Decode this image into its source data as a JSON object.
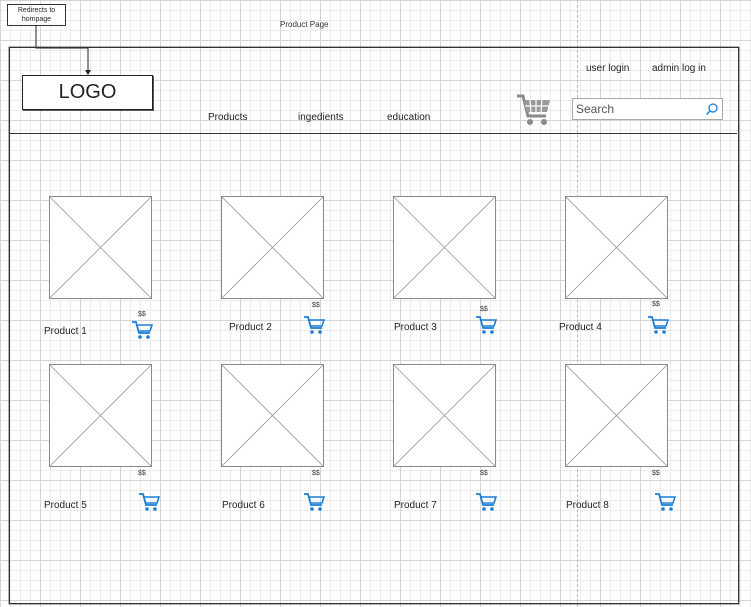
{
  "annotation": {
    "redirect_note": "Redirects to hompage"
  },
  "page_title": "Product Page",
  "header": {
    "logo": "LOGO",
    "nav": [
      "Products",
      "ingedients",
      "education"
    ],
    "user_login": "user login",
    "admin_login": "admin log in",
    "search_placeholder": "Search",
    "icons": {
      "cart": "shopping-cart-icon",
      "search": "search-icon"
    }
  },
  "products": [
    {
      "name": "Product 1",
      "price": "$$"
    },
    {
      "name": "Product 2",
      "price": "$$"
    },
    {
      "name": "Product 3",
      "price": "$$"
    },
    {
      "name": "Product 4",
      "price": "$$"
    },
    {
      "name": "Product 5",
      "price": "$$"
    },
    {
      "name": "Product 6",
      "price": "$$"
    },
    {
      "name": "Product 7",
      "price": "$$"
    },
    {
      "name": "Product 8",
      "price": "$$"
    }
  ],
  "colors": {
    "accent": "#1a7fd4",
    "cart_gray": "#8a8a8a"
  }
}
